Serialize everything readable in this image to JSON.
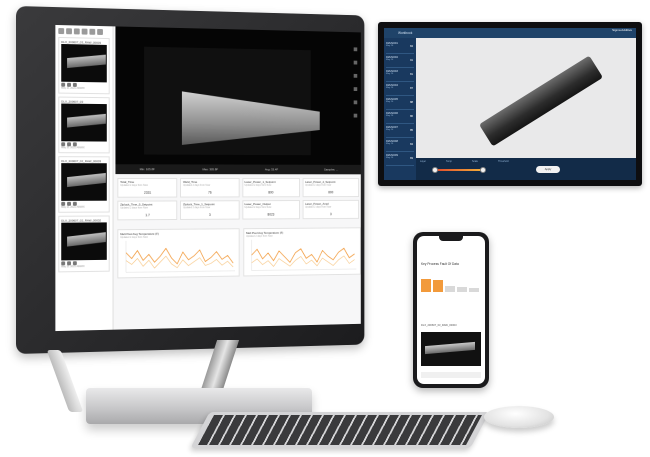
{
  "desktop": {
    "sidebar": {
      "cards": [
        {
          "caption": "DLX_200607_03_RAW_00003",
          "sub": "May 21 2021 AM/MX"
        },
        {
          "caption": "DLX_200607_03",
          "sub": "May 21 2021 AM/MX"
        },
        {
          "caption": "DLX_200607_02_RAW_00003",
          "sub": "May 21 2021 AM/MX"
        },
        {
          "caption": "DLX_200607_02_RAW_00002",
          "sub": "May 21 2021 AM/MX"
        },
        {
          "caption": "DLX_200607_04",
          "sub": "May 21 2021 AM/MX"
        },
        {
          "caption": "DLX_200607_03_RAW_00003",
          "sub": "May 21 2021 AM/MX"
        }
      ]
    },
    "viewer": {
      "labels": [
        "Min: 105.8F",
        "Max: 305.8F",
        "Avg: 33.4F",
        "Samples: ..."
      ]
    },
    "stats": [
      {
        "title": "Total_Time",
        "sub": "Updated 2 days from Now",
        "value": "2331"
      },
      {
        "title": "Weld_Time",
        "sub": "Updated 2 days from Now",
        "value": "76"
      },
      {
        "title": "Laser_Power_1_Setpoint",
        "sub": "Updated 2 days from Now",
        "value": "800"
      },
      {
        "title": "Laser_Power_2_Setpoint",
        "sub": "Updated 2 days from Now",
        "value": "800"
      },
      {
        "title": "Ziplock_Time_0_Setpoint",
        "sub": "Updated 2 days from Now",
        "value": "1.7"
      },
      {
        "title": "Ziplock_Time_1_Setpoint",
        "sub": "Updated 2 days from Now",
        "value": "3"
      },
      {
        "title": "Laser_Power_Output",
        "sub": "Updated 2 days from Now",
        "value": "8023"
      },
      {
        "title": "Laser_Power_Ampl",
        "sub": "Updated 2 days from Now",
        "value": "3"
      }
    ],
    "charts": [
      {
        "title": "Melt Pool Avg Temperature (F)",
        "sub": "Updated 2 days from Now"
      },
      {
        "title": "Melt Pool Avg Temperature (F)",
        "sub": "Updated 2 days from Now"
      }
    ]
  },
  "laptop": {
    "tab": "Workbook",
    "logo": "Sigma Additive",
    "items": [
      {
        "name": "DMLS0001",
        "date": "May 26",
        "metric": "84"
      },
      {
        "name": "DMLS0002",
        "date": "May 26",
        "metric": "91"
      },
      {
        "name": "DMLS0003",
        "date": "May 26",
        "metric": "81"
      },
      {
        "name": "DMLS0004",
        "date": "May 26",
        "metric": "87"
      },
      {
        "name": "DMLS0005",
        "date": "May 26",
        "metric": "88"
      },
      {
        "name": "DMLS0006",
        "date": "May 26",
        "metric": "86"
      },
      {
        "name": "DMLS0007",
        "date": "May 26",
        "metric": "85"
      },
      {
        "name": "DMLS0008",
        "date": "May 26",
        "metric": "84"
      },
      {
        "name": "DMLS0009",
        "date": "May 26",
        "metric": "83"
      }
    ],
    "bottom_labels": [
      "Layer",
      "Temp",
      "Scale",
      "Threshold"
    ],
    "apply_label": "Apply"
  },
  "phone": {
    "title": "Key Process Fault Of Data",
    "bars": [
      0.8,
      0.75,
      0.35,
      0.3,
      0.25
    ],
    "card_title": "DLX_200607_03_RAW_00003"
  },
  "colors": {
    "accent_orange": "#f29a3b",
    "laptop_navy": "#19395f"
  }
}
